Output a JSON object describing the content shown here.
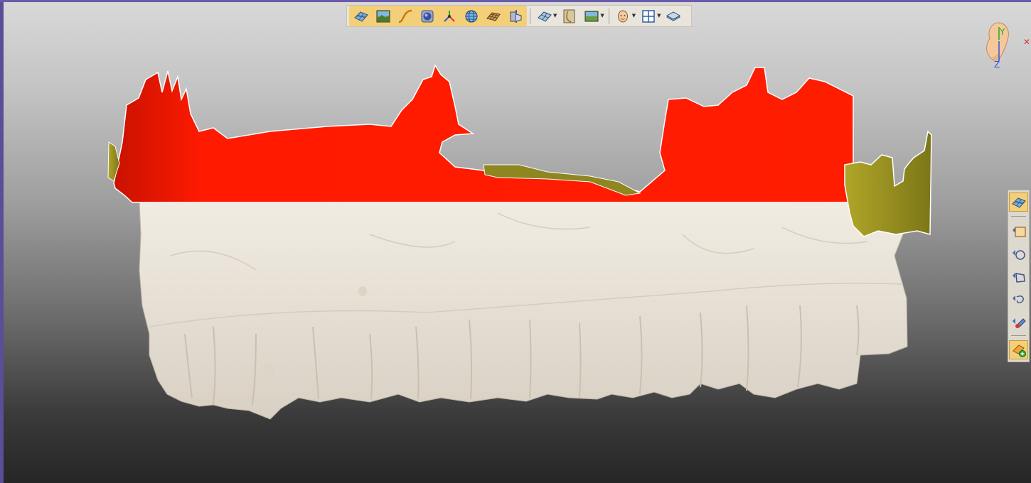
{
  "viewport": {
    "background_top": "#d9d9d9",
    "background_bottom": "#262626"
  },
  "model": {
    "upper_region_color": "#ff1a00",
    "side_region_color": "#9a9a22",
    "teeth_color": "#ece6dc"
  },
  "toolbar": {
    "tools": [
      {
        "name": "mesh-view",
        "icon": "mesh-icon"
      },
      {
        "name": "texture-view",
        "icon": "landscape-icon"
      },
      {
        "name": "curve-tool",
        "icon": "curve-icon"
      },
      {
        "name": "sphere-tool",
        "icon": "sphere-icon"
      },
      {
        "name": "axis-tool",
        "icon": "axis-icon"
      },
      {
        "name": "globe-view",
        "icon": "globe-icon"
      },
      {
        "name": "grid-surface",
        "icon": "grid-surface-icon"
      },
      {
        "name": "section-tool",
        "icon": "section-icon"
      },
      {
        "name": "mesh-options",
        "icon": "mesh-dropdown-icon"
      },
      {
        "name": "profile-view",
        "icon": "profile-icon"
      },
      {
        "name": "image-options",
        "icon": "image-dropdown-icon"
      },
      {
        "name": "face-options",
        "icon": "face-icon"
      },
      {
        "name": "layout-options",
        "icon": "layout-icon"
      },
      {
        "name": "layers",
        "icon": "layers-icon"
      }
    ]
  },
  "right_panel": {
    "tools": [
      {
        "name": "mesh-select",
        "icon": "mesh-icon",
        "active": true
      },
      {
        "name": "rect-select",
        "icon": "rect-select-icon"
      },
      {
        "name": "circle-select",
        "icon": "circle-select-icon"
      },
      {
        "name": "poly-select",
        "icon": "poly-select-icon"
      },
      {
        "name": "lasso-select",
        "icon": "lasso-select-icon"
      },
      {
        "name": "brush-select",
        "icon": "brush-select-icon"
      },
      {
        "name": "add-region",
        "icon": "add-region-icon",
        "active": true
      }
    ]
  },
  "orientation": {
    "y_label": "Y",
    "z_label": "Z",
    "x_label": "✕",
    "y_color": "#22aa22",
    "z_color": "#3355dd",
    "x_color": "#dd3333"
  }
}
